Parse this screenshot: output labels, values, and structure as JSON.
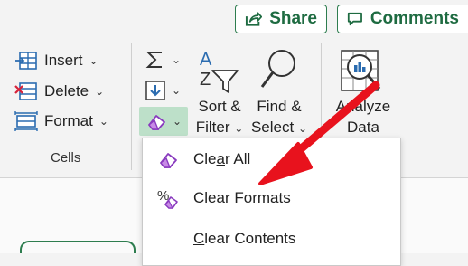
{
  "topbar": {
    "share_label": "Share",
    "comments_label": "Comments"
  },
  "cells_group": {
    "insert_label": "Insert",
    "delete_label": "Delete",
    "format_label": "Format",
    "group_label": "Cells"
  },
  "editing_group": {
    "sort_filter_line1": "Sort &",
    "sort_filter_line2": "Filter",
    "find_select_line1": "Find &",
    "find_select_line2": "Select"
  },
  "analysis_group": {
    "analyze_line1": "Analyze",
    "analyze_line2": "Data"
  },
  "clear_menu": {
    "items": [
      {
        "pre": "Cle",
        "key": "a",
        "post": "r All"
      },
      {
        "pre": "Clear ",
        "key": "F",
        "post": "ormats"
      },
      {
        "pre": "",
        "key": "C",
        "post": "lear Contents"
      }
    ]
  },
  "colors": {
    "accent_green": "#1e6b41",
    "arrow_red": "#e8121d",
    "selected_button_bg": "#bde0c9"
  }
}
